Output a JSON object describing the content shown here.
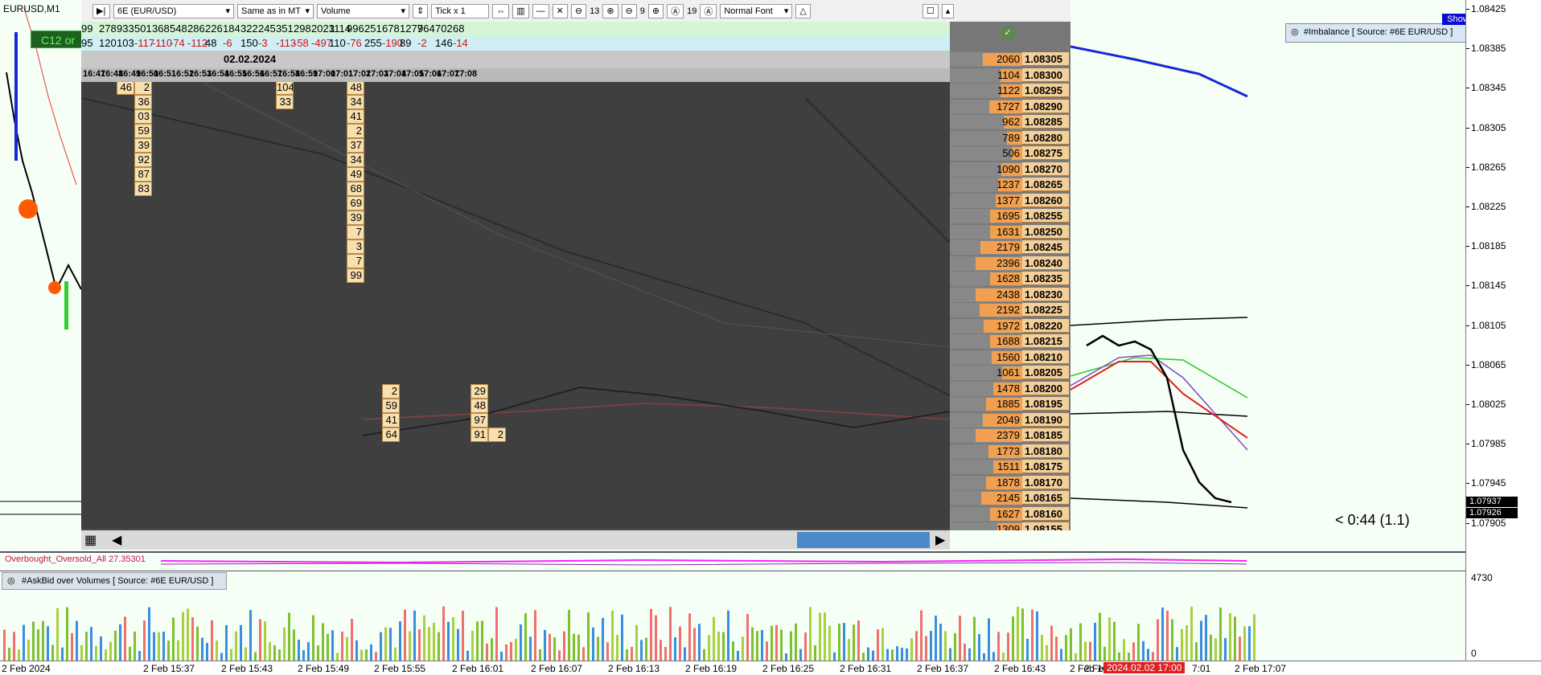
{
  "window": {
    "symbol": "EURUSD,M1",
    "c12_label": "C12 or"
  },
  "toolbar": {
    "instrument": "6E (EUR/USD)",
    "timezone": "Same as in MT",
    "mode": "Volume",
    "tick": "Tick x 1",
    "zoom_a": "13",
    "zoom_b": "9",
    "zoom_c": "19",
    "font": "Normal Font"
  },
  "footprint": {
    "top_row_green": [
      "99",
      "278",
      "933",
      "501",
      "368",
      "548",
      "286",
      "226",
      "184",
      "322",
      "245",
      "351",
      "298",
      "2023",
      "1114",
      "996",
      "251",
      "678",
      "1277",
      "964",
      "702",
      "68"
    ],
    "top_row_cyan": [
      "95",
      "120",
      "103",
      "-117",
      "-110",
      "-74",
      "-112",
      "48",
      "-6",
      "150",
      "-3",
      "-113",
      "-58",
      "-497",
      "110",
      "-76",
      "255",
      "-190",
      "89",
      "-2",
      "146",
      "-14"
    ],
    "date": "02.02.2024",
    "times": [
      "16:47",
      "16:48",
      "16:49",
      "16:50",
      "16:51",
      "16:52",
      "16:53",
      "16:54",
      "16:55",
      "16:56",
      "16:57",
      "16:58",
      "16:59",
      "17:00",
      "17:01",
      "17:02",
      "17:03",
      "17:04",
      "17:05",
      "17:06",
      "17:07",
      "17:08"
    ]
  },
  "dom": {
    "rows": [
      {
        "vol": "2060",
        "price": "1.08305",
        "fill": 0.55
      },
      {
        "vol": "1104",
        "price": "1.08300",
        "fill": 0.3
      },
      {
        "vol": "1122",
        "price": "1.08295",
        "fill": 0.3
      },
      {
        "vol": "1727",
        "price": "1.08290",
        "fill": 0.46
      },
      {
        "vol": "962",
        "price": "1.08285",
        "fill": 0.26
      },
      {
        "vol": "789",
        "price": "1.08280",
        "fill": 0.21
      },
      {
        "vol": "506",
        "price": "1.08275",
        "fill": 0.14
      },
      {
        "vol": "1090",
        "price": "1.08270",
        "fill": 0.29
      },
      {
        "vol": "1237",
        "price": "1.08265",
        "fill": 0.33
      },
      {
        "vol": "1377",
        "price": "1.08260",
        "fill": 0.37
      },
      {
        "vol": "1695",
        "price": "1.08255",
        "fill": 0.45
      },
      {
        "vol": "1631",
        "price": "1.08250",
        "fill": 0.44
      },
      {
        "vol": "2179",
        "price": "1.08245",
        "fill": 0.58
      },
      {
        "vol": "2396",
        "price": "1.08240",
        "fill": 0.64
      },
      {
        "vol": "1628",
        "price": "1.08235",
        "fill": 0.44
      },
      {
        "vol": "2438",
        "price": "1.08230",
        "fill": 0.65
      },
      {
        "vol": "2192",
        "price": "1.08225",
        "fill": 0.59
      },
      {
        "vol": "1972",
        "price": "1.08220",
        "fill": 0.53
      },
      {
        "vol": "1688",
        "price": "1.08215",
        "fill": 0.45
      },
      {
        "vol": "1560",
        "price": "1.08210",
        "fill": 0.42
      },
      {
        "vol": "1061",
        "price": "1.08205",
        "fill": 0.28
      },
      {
        "vol": "1478",
        "price": "1.08200",
        "fill": 0.4
      },
      {
        "vol": "1885",
        "price": "1.08195",
        "fill": 0.5
      },
      {
        "vol": "2049",
        "price": "1.08190",
        "fill": 0.55
      },
      {
        "vol": "2379",
        "price": "1.08185",
        "fill": 0.64
      },
      {
        "vol": "1773",
        "price": "1.08180",
        "fill": 0.47
      },
      {
        "vol": "1511",
        "price": "1.08175",
        "fill": 0.4
      },
      {
        "vol": "1878",
        "price": "1.08170",
        "fill": 0.5
      },
      {
        "vol": "2145",
        "price": "1.08165",
        "fill": 0.57
      },
      {
        "vol": "1627",
        "price": "1.08160",
        "fill": 0.44
      },
      {
        "vol": "1309",
        "price": "1.08155",
        "fill": 0.35
      }
    ]
  },
  "price_axis": {
    "labels": [
      "1.08425",
      "1.08385",
      "1.08345",
      "1.08305",
      "1.08265",
      "1.08225",
      "1.08185",
      "1.08145",
      "1.08105",
      "1.08065",
      "1.08025",
      "1.07985",
      "1.07945",
      "1.07905"
    ],
    "current_a": "1.07937",
    "current_b": "1.07926",
    "vol_high": "4730",
    "vol_low": "0"
  },
  "indicators": {
    "imbalance": "#Imbalance [ Source: #6E EUR/USD ]",
    "show": "Show",
    "countdown": "< 0:44 (1.1)",
    "oscillator": "Overbought_Oversold_All 27.35301",
    "askbid": "#AskBid over Volumes [ Source: #6E EUR/USD ]"
  },
  "time_axis": {
    "labels": [
      "2 Feb 2024",
      "2 Feb 15:37",
      "2 Feb 15:43",
      "2 Feb 15:49",
      "2 Feb 15:55",
      "2 Feb 16:01",
      "2 Feb 16:07",
      "2 Feb 16:13",
      "2 Feb 16:19",
      "2 Feb 16:25",
      "2 Feb 16:31",
      "2 Feb 16:37",
      "2 Feb 16:43",
      "2 Feb 16:49",
      "2 Feb",
      "2 Feb 17:07"
    ],
    "cursor": "2024.02.02 17:00",
    "cursor_suffix": "7:01"
  },
  "colors": {
    "dom_fill": "#f0a050",
    "cursor_line": "#e02020",
    "blue_ma": "#1428d8"
  }
}
